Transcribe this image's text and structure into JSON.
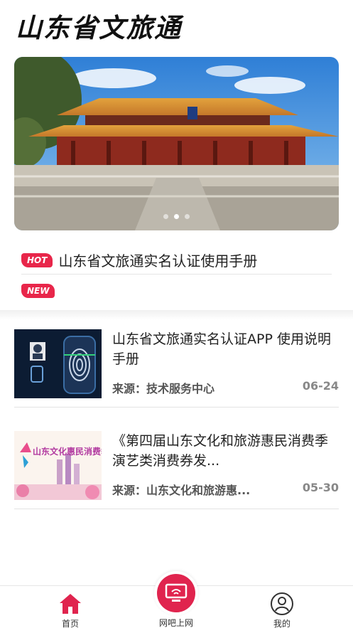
{
  "app": {
    "title": "山东省文旅通"
  },
  "banner": {
    "dots": 3,
    "active_dot": 0
  },
  "notices": [
    {
      "badge": "HOT",
      "text": "山东省文旅通实名认证使用手册"
    },
    {
      "badge": "NEW",
      "text": ""
    }
  ],
  "news": [
    {
      "title": "山东省文旅通实名认证APP 使用说明手册",
      "source": "来源：技术服务中心",
      "date": "06-24",
      "thumb_icon": "face-fingerprint-scan-image"
    },
    {
      "title": "《第四届山东文化和旅游惠民消费季演艺类消费券发...",
      "source": "来源：山东文化和旅游惠...",
      "date": "05-30",
      "thumb_icon": "consumption-season-poster-image",
      "thumb_text": "山东文化惠民消费季"
    }
  ],
  "tabbar": {
    "home": {
      "label": "首页",
      "icon": "home-icon"
    },
    "center": {
      "label": "网吧上网",
      "icon": "monitor-wifi-icon"
    },
    "mine": {
      "label": "我的",
      "icon": "user-icon"
    }
  },
  "colors": {
    "accent": "#e0244e",
    "badge": "#e8264a"
  }
}
